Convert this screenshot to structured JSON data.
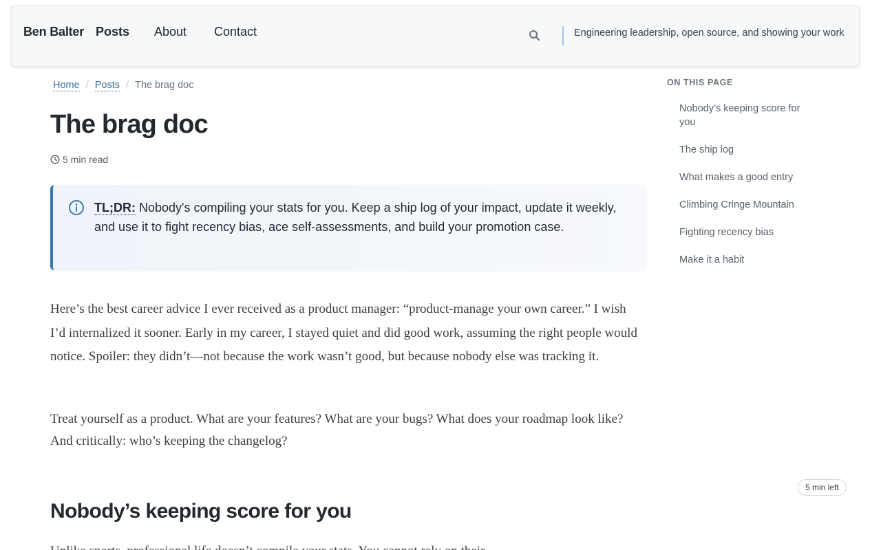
{
  "header": {
    "brand": "Ben Balter",
    "nav": [
      "Posts",
      "About",
      "Contact"
    ],
    "tagline": "Engineering leadership, open source, and showing your work",
    "icons": {
      "search": "search-icon"
    }
  },
  "breadcrumb": {
    "items": [
      "Home",
      "Posts"
    ],
    "separator": "/",
    "current": "The brag doc"
  },
  "article": {
    "title": "The brag doc",
    "read_time": "5 min read",
    "tldr": {
      "label": "TL;DR:",
      "text": "Nobody's compiling your stats for you. Keep a ship log of your impact, update it weekly, and use it to fight recency bias, ace self-assessments, and build your promotion case."
    },
    "paragraphs": [
      "Here’s the best career advice I ever received as a product manager: “product-manage your own career.” I wish I’d internalized it sooner. Early in my career, I stayed quiet and did good work, as­suming the right people would notice. Spoiler: they didn’t—not because the work wasn’t good, but because nobody else was tracking it.",
      "Treat yourself as a product. What are your features? What are your bugs? What does your roadmap look like? And critically: who’s keeping the changelog?"
    ],
    "section_heading": "Nobody’s keeping score for you",
    "section_paragraph": "Unlike sports, professional life doesn’t compile your stats. You cannot rely on their"
  },
  "toc": {
    "title": "ON THIS PAGE",
    "items": [
      "Nobody’s keeping score for you",
      "The ship log",
      "What makes a good entry",
      "Climbing Cringe Mountain",
      "Fighting recency bias",
      "Make it a habit"
    ]
  },
  "time_left": "5 min left",
  "colors": {
    "accent": "#3a78b0",
    "link": "#3a6f9e",
    "header_bg": "#f6f8fa"
  }
}
